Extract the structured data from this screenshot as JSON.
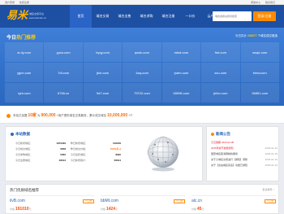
{
  "topbar": {
    "welcome": "用户登录",
    "register": "免费注册",
    "help": "帮助中心",
    "contact": "联系我们"
  },
  "header": {
    "logo_mark": "易米",
    "logo_sub1": "域名交易平台",
    "logo_sub2": "www.domain.cn",
    "nav": [
      "首页",
      "域名交易",
      "域名出售",
      "域名求购",
      "域名注册",
      "一口价",
      "云产品",
      "新闻资讯"
    ],
    "search_placeholder": "域名或者关键词搜索",
    "login_label": "登录/注册"
  },
  "banner": {
    "title_prefix": "今日",
    "title_highlight": "热门推荐",
    "title_suffix": "推荐",
    "stat_prefix": "今日共计",
    "stat_value": "208377",
    "stat_suffix": "个域名成交候选",
    "domains": [
      "si.dy.com",
      "yyca.com",
      "hyqy.com",
      "qwdc.com",
      "mbdr.com",
      "fmt.com",
      "swqe.com",
      "yjpm.com",
      "7dl.com",
      "jfcb.com",
      "1wq.com",
      "ywlm.com",
      "sxu.com",
      "fnhw.com",
      "xjzh.com",
      "6766.cn",
      "9d7.com",
      "79722.com",
      "65996.com",
      "jbfxn.com",
      "96851.com"
    ]
  },
  "notice": {
    "prefix": "本站已加盟",
    "count": "10家",
    "mid": "为",
    "users": "900,000",
    "mid2": "+用户提供域名交易服务，累计成交域名",
    "total": "10,000,000",
    "suffix": "+个"
  },
  "stats_panel": {
    "title": "本站数据",
    "rows": [
      {
        "label": "今日新增域名：",
        "value": "1979409",
        "orange": false
      },
      {
        "label": "昨日新增域名：",
        "value": "126239",
        "orange": false
      },
      {
        "label": "今日成交域名：",
        "value": "6658",
        "orange": false
      },
      {
        "label": "昨日成交价格：",
        "value": "1524(万+)",
        "orange": true
      },
      {
        "label": "今日求购域名：",
        "value": "5060",
        "orange": false
      },
      {
        "label": "今日出售域名：",
        "value": "8990",
        "orange": false
      },
      {
        "label": "今日注册域名：",
        "value": "48013",
        "orange": false
      },
      {
        "label": "今日新增用户：",
        "value": "66644",
        "orange": false
      }
    ]
  },
  "news": {
    "title": "新闻公告",
    "items": [
      {
        "text": "元旦假期 2025-02-08",
        "date": "",
        "red": true
      },
      {
        "text": "2025年春节放假通知",
        "date": "2025-01-22",
        "red": true
      },
      {
        "text": "国家域名取消限制的服务",
        "date": "2025-01-18",
        "red": false
      },
      {
        "text": "关于子域名交易进行【通知】调整",
        "date": "2025-01-16",
        "red": false
      },
      {
        "text": "关于【全站域名实名】功能已通知",
        "date": "2025-01-16",
        "red": false
      }
    ]
  },
  "hot": {
    "title": "热门优质域名推荐",
    "more": "更多推荐 >",
    "cards": [
      {
        "domain": "ilvB.com",
        "tag": "一口价",
        "price_label": "价格",
        "price": "191010",
        "unit": "元"
      },
      {
        "domain": "bbMt.com",
        "tag": "一口价",
        "price_label": "价格",
        "price": "1424",
        "unit": "元"
      },
      {
        "domain": "alc.cn",
        "tag": "一口价",
        "price_label": "价格",
        "price": "45",
        "unit": "元"
      }
    ]
  },
  "colors": {
    "brand_blue": "#1d4fa3",
    "banner_blue": "#2f6fc9",
    "accent_orange": "#ff8a00",
    "highlight_yellow": "#ffcc00"
  }
}
